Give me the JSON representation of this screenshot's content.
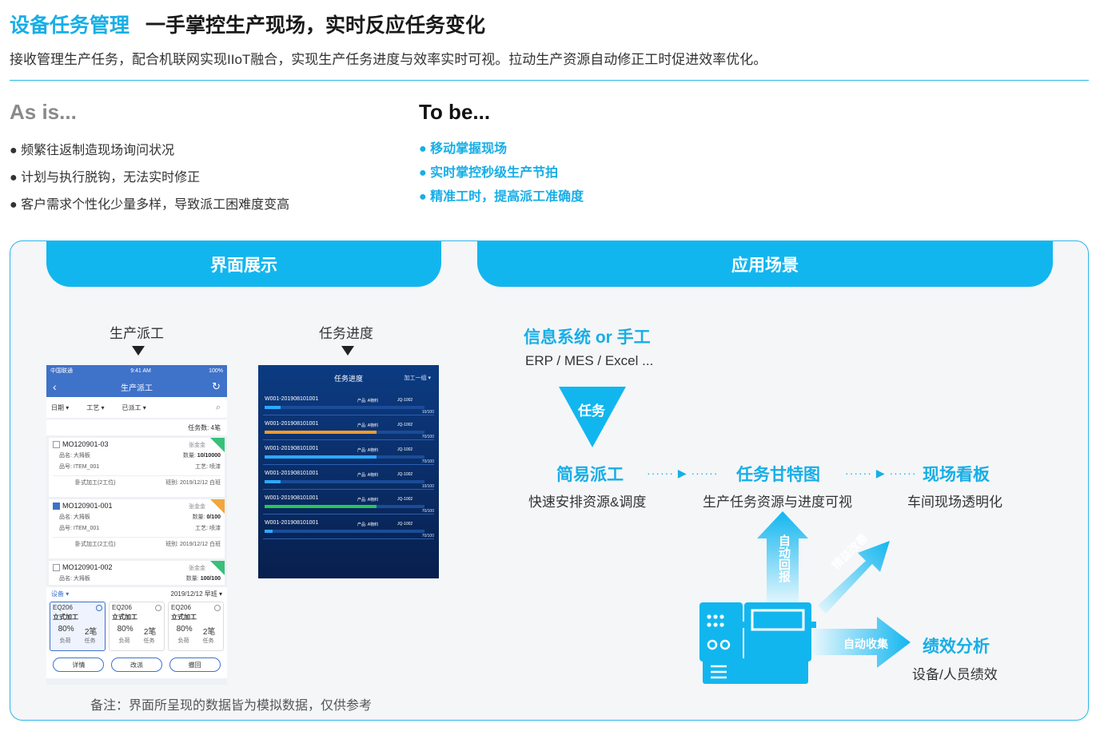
{
  "header": {
    "accent_title": "设备任务管理",
    "main_title": "一手掌控生产现场，实时反应任务变化",
    "description": "接收管理生产任务，配合机联网实现IIoT融合，实现生产任务进度与效率实时可视。拉动生产资源自动修正工时促进效率优化。"
  },
  "as_is": {
    "title": "As is...",
    "items": [
      "● 频繁往返制造现场询问状况",
      "● 计划与执行脱钩，无法实时修正",
      "● 客户需求个性化少量多样，导致派工困难度变高"
    ]
  },
  "to_be": {
    "title": "To be...",
    "items": [
      "● 移动掌握现场",
      "● 实时掌控秒级生产节拍",
      "● 精准工时，提高派工准确度"
    ]
  },
  "panel": {
    "left_tab": "界面展示",
    "right_tab": "应用场景",
    "note": "备注：界面所呈现的数据皆为模拟数据，仅供参考"
  },
  "screens": {
    "dispatch_caption": "生产派工",
    "progress_caption": "任务进度"
  },
  "phone": {
    "carrier": "中国联通",
    "time": "9:41 AM",
    "battery": "100%",
    "title": "生产派工",
    "filters": [
      "日期 ▾",
      "工艺 ▾",
      "已派工 ▾"
    ],
    "task_count": "任务数: 4笔",
    "cards": [
      {
        "mo": "MO120901-03",
        "owner": "张金金",
        "name": "品名: 大拇板",
        "qty_label": "数量:",
        "qty": "10/10000",
        "item": "品号: ITEM_001",
        "craft": "工艺: 喷漆",
        "process": "卧式加工(2工位)",
        "shift": "班别: 2019/12/12 白班",
        "checked": false
      },
      {
        "mo": "MO120901-001",
        "owner": "张金金",
        "name": "品名: 大拇板",
        "qty_label": "数量:",
        "qty": "0/100",
        "item": "品号: ITEM_001",
        "craft": "工艺: 喷漆",
        "process": "卧式加工(2工位)",
        "shift": "班别: 2019/12/12 白班",
        "checked": true
      },
      {
        "mo": "MO120901-002",
        "owner": "张金金",
        "name": "品名: 大拇板",
        "qty_label": "数量:",
        "qty": "100/100",
        "checked": false
      }
    ],
    "equip_label": "设备 ▾",
    "equip_shift": "2019/12/12 早班 ▾",
    "equipments": [
      {
        "code": "EQ206",
        "name": "立式加工",
        "load": "80%",
        "tasks": "2笔",
        "load_label": "负荷",
        "task_label": "任务"
      },
      {
        "code": "EQ206",
        "name": "立式加工",
        "load": "80%",
        "tasks": "2笔",
        "load_label": "负荷",
        "task_label": "任务"
      },
      {
        "code": "EQ206",
        "name": "立式加工",
        "load": "80%",
        "tasks": "2笔",
        "load_label": "负荷",
        "task_label": "任务"
      }
    ],
    "buttons": [
      "详情",
      "改派",
      "撤回"
    ]
  },
  "dashboard": {
    "title": "任务进度",
    "filter": "加工一组 ▾",
    "rows": [
      {
        "id": "W001-201908101001",
        "product": "产品: A物料",
        "machine": "JQ-1002",
        "progress": "10/100",
        "ratio": 0.1,
        "color": "#2ea8ff"
      },
      {
        "id": "W001-201908101001",
        "product": "产品: A物料",
        "machine": "JQ-1002",
        "progress": "70/100",
        "ratio": 0.7,
        "color": "#f39b2a"
      },
      {
        "id": "W001-201908101001",
        "product": "产品: A物料",
        "machine": "JQ-1002",
        "progress": "70/100",
        "ratio": 0.7,
        "color": "#2ea8ff"
      },
      {
        "id": "W001-201908101001",
        "product": "产品: A物料",
        "machine": "JQ-1002",
        "progress": "10/100",
        "ratio": 0.1,
        "color": "#2ea8ff"
      },
      {
        "id": "W001-201908101001",
        "product": "产品: A物料",
        "machine": "JQ-1002",
        "progress": "70/100",
        "ratio": 0.7,
        "color": "#27c65a"
      },
      {
        "id": "W001-201908101001",
        "product": "产品: A物料",
        "machine": "JQ-1002",
        "progress": "70/100",
        "ratio": 0.05,
        "color": "#2ea8ff"
      }
    ]
  },
  "scenario": {
    "source_title": "信息系统 or 手工",
    "source_sub": "ERP / MES / Excel ...",
    "funnel_label": "任务",
    "dispatch_title": "简易派工",
    "dispatch_sub": "快速安排资源&调度",
    "gantt_title": "任务甘特图",
    "gantt_sub": "生产任务资源与进度可视",
    "board_title": "现场看板",
    "board_sub": "车间现场透明化",
    "auto_report": "自动回报",
    "auto_learn": "精益改善",
    "auto_collect": "自动收集",
    "perf_title": "绩效分析",
    "perf_sub": "设备/人员绩效",
    "colors": {
      "accent": "#12b6ef",
      "accent_light": "#8fdaf7"
    }
  }
}
